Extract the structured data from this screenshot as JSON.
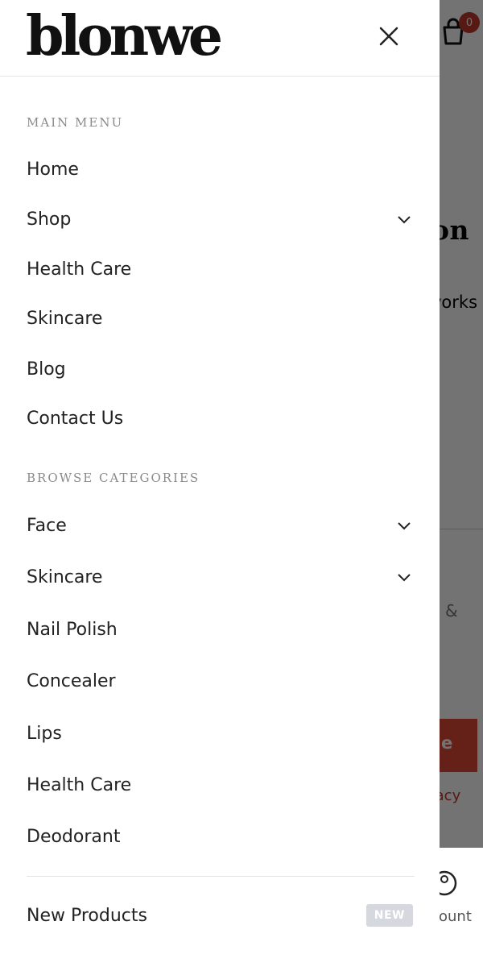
{
  "drawer": {
    "brand": "blonwe",
    "main_menu": {
      "heading": "MAIN MENU",
      "items": [
        {
          "label": "Home",
          "has_submenu": false
        },
        {
          "label": "Shop",
          "has_submenu": true
        },
        {
          "label": "Health Care",
          "has_submenu": false
        },
        {
          "label": "Skincare",
          "has_submenu": false
        },
        {
          "label": "Blog",
          "has_submenu": false
        },
        {
          "label": "Contact Us",
          "has_submenu": false
        }
      ]
    },
    "browse_categories": {
      "heading": "BROWSE CATEGORIES",
      "items": [
        {
          "label": "Face",
          "has_submenu": true
        },
        {
          "label": "Skincare",
          "has_submenu": true
        },
        {
          "label": "Nail Polish",
          "has_submenu": false
        },
        {
          "label": "Concealer",
          "has_submenu": false
        },
        {
          "label": "Lips",
          "has_submenu": false
        },
        {
          "label": "Health Care",
          "has_submenu": false
        },
        {
          "label": "Deodorant",
          "has_submenu": false
        }
      ]
    },
    "new_products": {
      "label": "New Products",
      "badge": "NEW"
    }
  },
  "background": {
    "cart_count": "0",
    "heading_fragment": "on",
    "subtext_fragment": "vorks",
    "amp_fragment": "&",
    "button_fragment": "e",
    "privacy_fragment": "vacy",
    "account_fragment": "ount"
  },
  "colors": {
    "accent_red": "#e04a35",
    "text_dark": "#222222",
    "section_heading": "#8a8a8a",
    "badge_bg": "#d5d8de"
  }
}
